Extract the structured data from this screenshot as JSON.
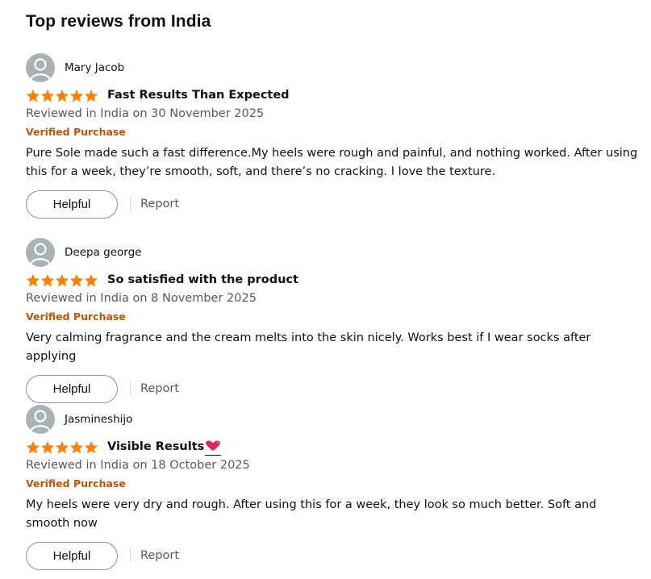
{
  "section": {
    "title": "Top reviews from India"
  },
  "colors": {
    "star": "#ff7f00",
    "verified": "#c45500",
    "heart": "#e0245e"
  },
  "reviews": [
    {
      "name": "Mary Jacob",
      "rating": 5,
      "title": "Fast Results Than Expected",
      "date": "Reviewed in India on 30 November 2025",
      "verified": "Verified Purchase",
      "body": "Pure Sole made such a fast difference.My heels were rough and painful, and nothing worked. After using this for a week, they’re smooth, soft, and there’s no cracking. I love the texture.",
      "helpful_label": "Helpful",
      "report_label": "Report"
    },
    {
      "name": "Deepa george",
      "rating": 5,
      "title": "So satisfied with the product",
      "date": "Reviewed in India on 8 November 2025",
      "verified": "Verified Purchase",
      "body": "Very calming fragrance and the cream melts into the skin nicely. Works best if I wear socks after applying",
      "helpful_label": "Helpful",
      "report_label": "Report"
    },
    {
      "name": "Jasmineshijo",
      "rating": 5,
      "title": "Visible Results",
      "title_icon": "heart-icon",
      "date": "Reviewed in India on 18 October 2025",
      "verified": "Verified Purchase",
      "body": "My heels were very dry and rough. After using this for a week, they look so much better. Soft and smooth now",
      "helpful_label": "Helpful",
      "report_label": "Report"
    }
  ]
}
